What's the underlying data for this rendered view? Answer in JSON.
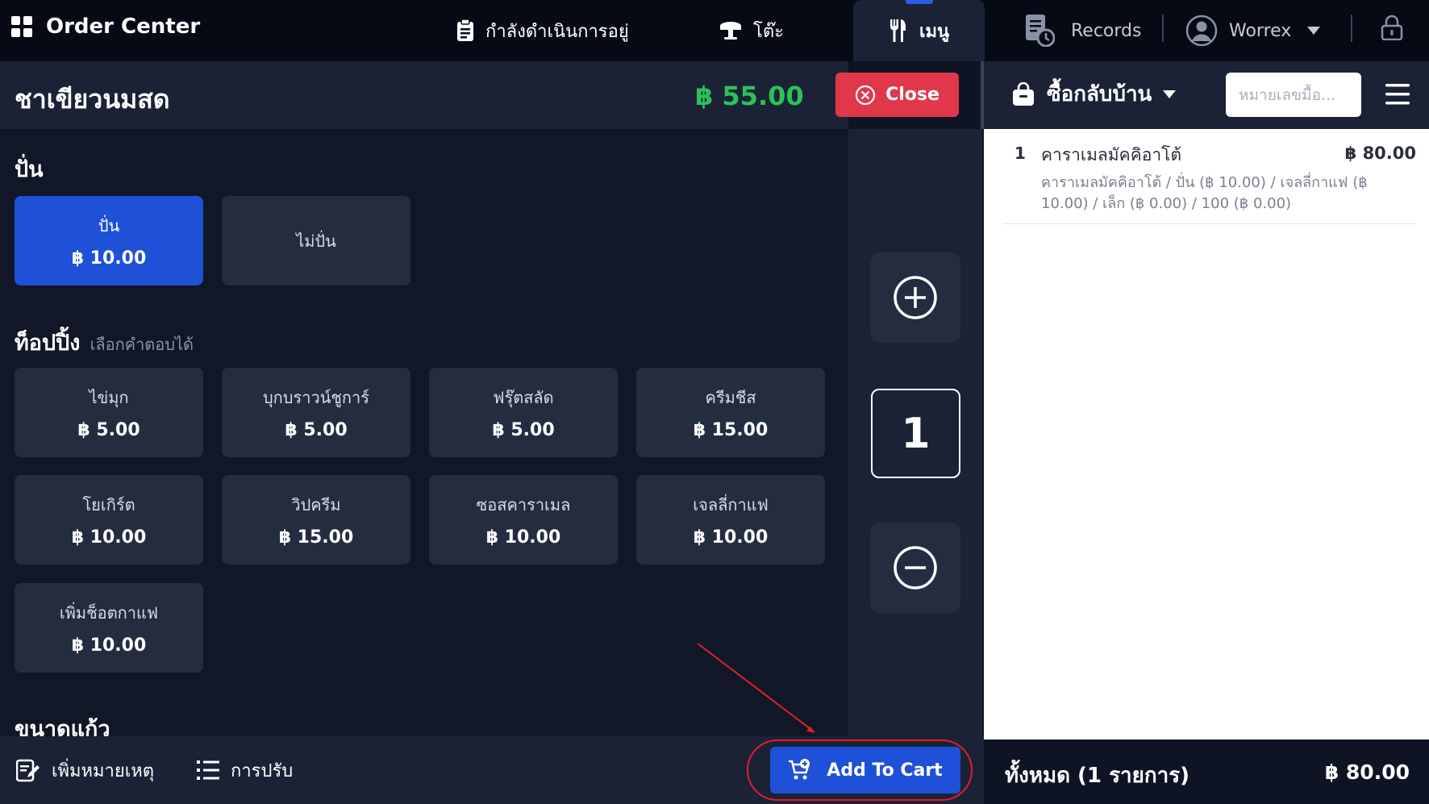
{
  "topbar": {
    "title": "Order Center",
    "tabs": [
      {
        "label": "กำลังดำเนินการอยู่",
        "icon": "clipboard-icon"
      },
      {
        "label": "โต๊ะ",
        "icon": "table-icon"
      },
      {
        "label": "เมนู",
        "icon": "fork-knife-icon",
        "active": true
      }
    ],
    "records_label": "Records",
    "user_name": "Worrex"
  },
  "item": {
    "name": "ชาเขียวนมสด",
    "price": "฿ 55.00",
    "close_label": "Close"
  },
  "groups": {
    "blend": {
      "title": "ปั่น",
      "options": [
        {
          "name": "ปั่น",
          "price": "฿ 10.00",
          "selected": true
        },
        {
          "name": "ไม่ปั่น",
          "price": ""
        }
      ]
    },
    "topping": {
      "title": "ท็อปปิ้ง",
      "hint": "เลือกคำตอบได้",
      "options": [
        {
          "name": "ไข่มุก",
          "price": "฿ 5.00"
        },
        {
          "name": "บุกบราวน์ชูการ์",
          "price": "฿ 5.00"
        },
        {
          "name": "ฟรุ๊ตสลัด",
          "price": "฿ 5.00"
        },
        {
          "name": "ครีมชีส",
          "price": "฿ 15.00"
        },
        {
          "name": "โยเกิร์ต",
          "price": "฿ 10.00"
        },
        {
          "name": "วิปครีม",
          "price": "฿ 15.00"
        },
        {
          "name": "ซอสคาราเมล",
          "price": "฿ 10.00"
        },
        {
          "name": "เจลลี่กาแฟ",
          "price": "฿ 10.00"
        },
        {
          "name": "เพิ่มช็อตกาแฟ",
          "price": "฿ 10.00"
        }
      ]
    },
    "cup_size": {
      "title": "ขนาดแก้ว"
    }
  },
  "quantity": "1",
  "cart": {
    "order_type": "ซื้อกลับบ้าน",
    "order_no_placeholder": "หมายเลขมื้อ...",
    "items": [
      {
        "qty": "1",
        "name": "คาราเมลมัคคิอาโต้",
        "price": "฿ 80.00",
        "modifiers": "คาราเมลมัคคิอาโต้  /  ปั่น (฿ 10.00)  /  เจลลี่กาแฟ (฿ 10.00)  /  เล็ก (฿ 0.00)  /  100 (฿ 0.00)"
      }
    ],
    "total_label": "ทั้งหมด (1 รายการ)",
    "total_amount": "฿ 80.00"
  },
  "bottombar": {
    "add_note_label": "เพิ่มหมายเหตุ",
    "adjust_label": "การปรับ",
    "add_to_cart_label": "Add To Cart"
  },
  "colors": {
    "accent": "#1e50d8",
    "price_green": "#29c35a",
    "close_red": "#e0384a",
    "annotation_red": "#e01f2d"
  }
}
